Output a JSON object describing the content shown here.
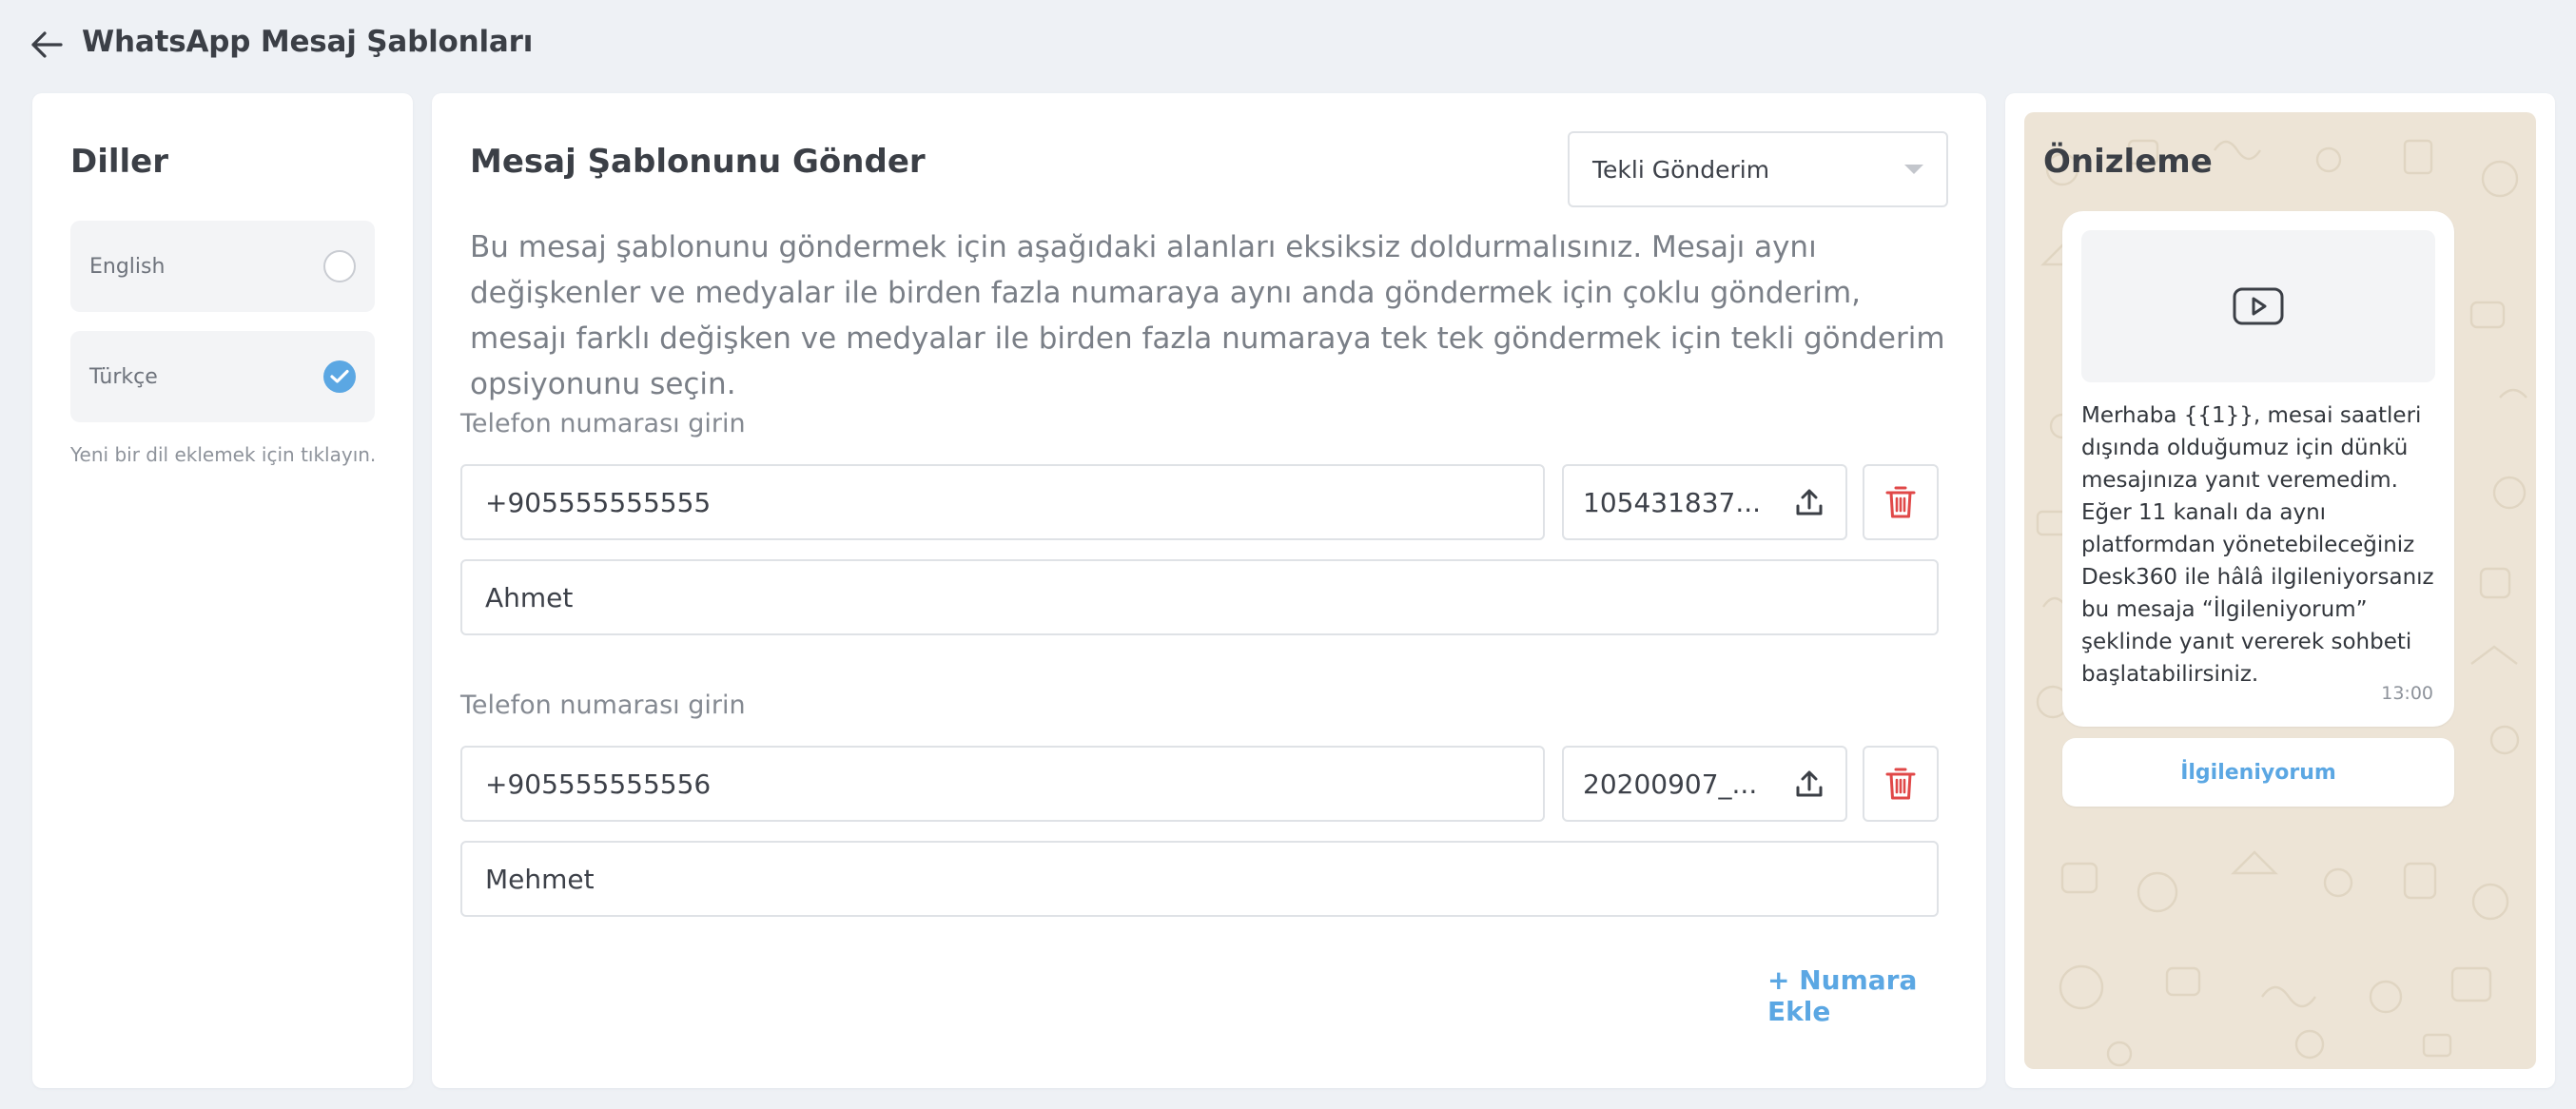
{
  "header": {
    "title": "WhatsApp Mesaj Şablonları"
  },
  "languages": {
    "title": "Diller",
    "items": [
      {
        "label": "English",
        "selected": false
      },
      {
        "label": "Türkçe",
        "selected": true
      }
    ],
    "hint": "Yeni bir dil eklemek için tıklayın."
  },
  "main": {
    "title": "Mesaj Şablonunu Gönder",
    "mode_select": {
      "value": "Tekli Gönderim"
    },
    "description": "Bu mesaj şablonunu göndermek için aşağıdaki alanları eksiksiz doldurmalısınız. Mesajı aynı değişkenler ve medyalar ile birden fazla numaraya aynı anda göndermek için çoklu gönderim, mesajı farklı değişken ve medyalar ile birden fazla numaraya tek tek göndermek için tekli gönderim opsiyonunu seçin.",
    "recipients": [
      {
        "label": "Telefon numarası girin",
        "phone": "+905555555555",
        "file": "105431837...",
        "variable": "Ahmet"
      },
      {
        "label": "Telefon numarası girin",
        "phone": "+905555555556",
        "file": "20200907_...",
        "variable": "Mehmet"
      }
    ],
    "add_number_label": "+ Numara Ekle"
  },
  "preview": {
    "title": "Önizleme",
    "message": "Merhaba {{1}}, mesai saatleri dışında olduğumuz için dünkü mesajınıza yanıt veremedim. Eğer 11 kanalı da aynı platformdan yönetebileceğiniz Desk360 ile hâlâ ilgileniyorsanız bu mesaja “İlgileniyorum” şeklinde yanıt vererek sohbeti başlatabilirsiniz.",
    "time": "13:00",
    "quick_reply": "İlgileniyorum",
    "wallpaper_color": "#ede4d6"
  },
  "colors": {
    "accent": "#5ba7e3",
    "danger": "#e04848",
    "page_bg": "#eef1f5"
  },
  "icons": {
    "back": "arrow-left-icon",
    "upload": "upload-icon",
    "delete": "trash-icon",
    "check": "check-icon",
    "play": "play-icon"
  }
}
